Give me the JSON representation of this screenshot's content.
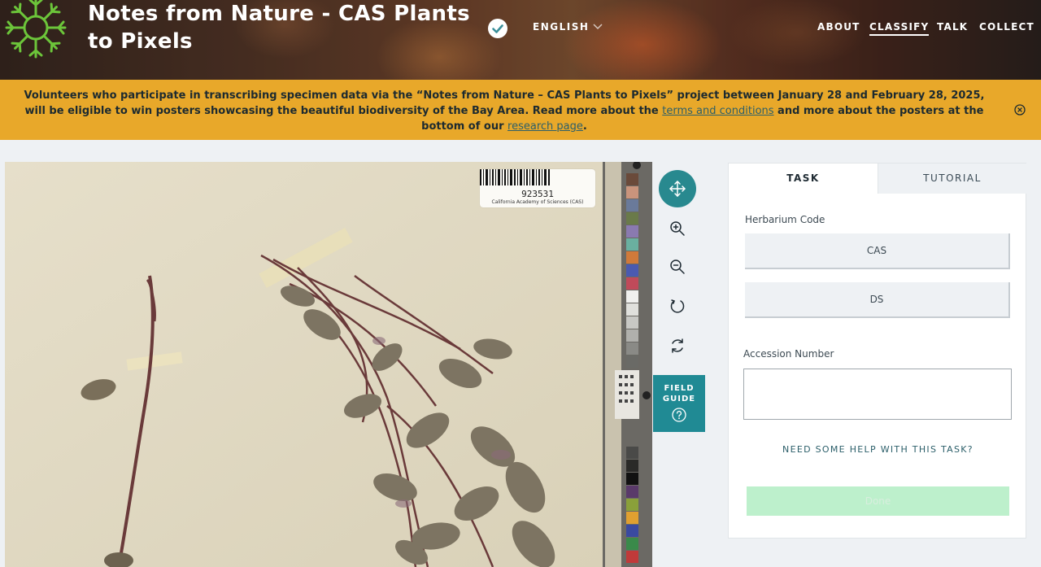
{
  "header": {
    "title": "Notes from Nature - CAS Plants to Pixels",
    "language": "ENGLISH",
    "nav": [
      {
        "label": "ABOUT",
        "active": false
      },
      {
        "label": "CLASSIFY",
        "active": true
      },
      {
        "label": "TALK",
        "active": false
      },
      {
        "label": "COLLECT",
        "active": false
      }
    ]
  },
  "banner": {
    "text_before": "Volunteers who participate in transcribing specimen data via the “Notes from Nature – CAS Plants to Pixels” project between January 28 and February 28, 2025, will be eligible to win posters showcasing the beautiful biodiversity of the Bay Area. Read more about the ",
    "link1": "terms and conditions",
    "text_middle": " and more about the posters at the bottom of our ",
    "link2": "research page",
    "text_after": "."
  },
  "subject": {
    "barcode_number": "923531",
    "institution": "California Academy of Sciences (CAS)"
  },
  "tools": {
    "items": [
      "move-icon",
      "zoom-in-icon",
      "zoom-out-icon",
      "rotate-icon",
      "reset-icon"
    ],
    "field_guide_line1": "FIELD",
    "field_guide_line2": "GUIDE"
  },
  "task_panel": {
    "tabs": [
      {
        "label": "TASK",
        "active": true
      },
      {
        "label": "TUTORIAL",
        "active": false
      }
    ],
    "herbarium_label": "Herbarium Code",
    "herbarium_options": [
      "CAS",
      "DS"
    ],
    "accession_label": "Accession Number",
    "accession_value": "",
    "help_link": "NEED SOME HELP WITH THIS TASK?",
    "done_label": "Done"
  },
  "colors": {
    "teal": "#28898f",
    "banner": "#e8a82a",
    "done_disabled": "#bdf0cc",
    "logo_green": "#6cc53a"
  }
}
